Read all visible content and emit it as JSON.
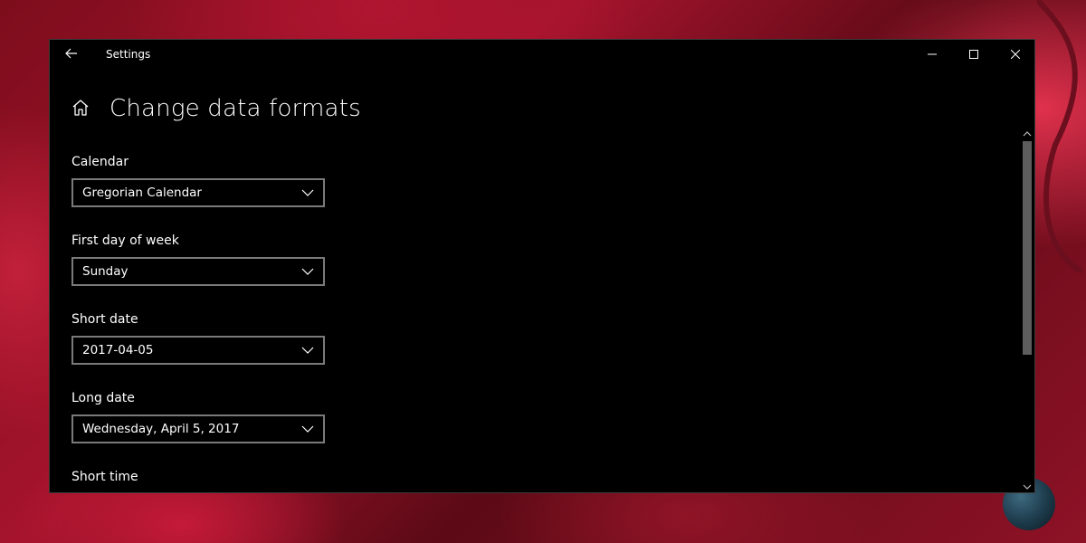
{
  "window": {
    "title": "Settings"
  },
  "page": {
    "title": "Change data formats"
  },
  "settings": [
    {
      "label": "Calendar",
      "value": "Gregorian Calendar"
    },
    {
      "label": "First day of week",
      "value": "Sunday"
    },
    {
      "label": "Short date",
      "value": "2017-04-05"
    },
    {
      "label": "Long date",
      "value": "Wednesday, April 5, 2017"
    },
    {
      "label": "Short time",
      "value": ""
    }
  ],
  "colors": {
    "window_bg": "#000000",
    "text": "#ffffff",
    "dropdown_border": "#7a7a7a",
    "wallpaper_accent": "#c41a38"
  },
  "icons": {
    "back": "arrow-left-icon",
    "home": "home-icon",
    "minimize": "minimize-icon",
    "maximize": "maximize-icon",
    "close": "close-icon",
    "dropdown": "chevron-down-icon"
  }
}
